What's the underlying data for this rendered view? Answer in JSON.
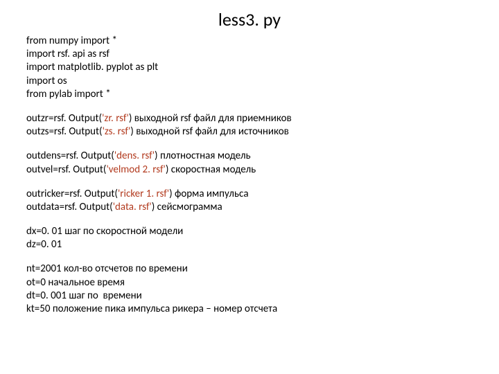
{
  "title": "less3. py",
  "imports": {
    "l1a": "from numpy import ",
    "l1b": "*",
    "l2a": "import rsf. api ",
    "l2b": "as ",
    "l2c": "rsf",
    "l3a": "import matplotlib. pyplot ",
    "l3b": "as ",
    "l3c": "plt",
    "l4a": "import os",
    "l5a": "from pylab import ",
    "l5b": "*"
  },
  "b1": {
    "l1a": "outzr=rsf. Output(",
    "l1b": "'zr. rsf'",
    "l1c": ") выходной rsf файл для приемников",
    "l2a": "outzs=rsf. Output(",
    "l2b": "'zs. rsf'",
    "l2c": ") выходной rsf файл для источников"
  },
  "b2": {
    "l1a": "outdens=rsf. Output(",
    "l1b": "'dens. rsf'",
    "l1c": ") плотностная модель",
    "l2a": "outvel=rsf. Output(",
    "l2b": "'velmod 2. rsf'",
    "l2c": ") скоростная модель"
  },
  "b3": {
    "l1a": "outricker=rsf. Output(",
    "l1b": "'ricker 1. rsf'",
    "l1c": ") форма импульса",
    "l2a": "outdata=rsf. Output(",
    "l2b": "'data. rsf'",
    "l2c": ") сейсмограмма"
  },
  "b4": {
    "l1": "dx=0. 01 шаг по скоростной модели",
    "l2": "dz=0. 01"
  },
  "b5": {
    "l1": "nt=2001 кол-во отсчетов по времени",
    "l2": "ot=0 начальное время",
    "l3": "dt=0. 001 шаг по  времени",
    "l4": "kt=50 положение пика импульса рикера – номер отсчета"
  }
}
